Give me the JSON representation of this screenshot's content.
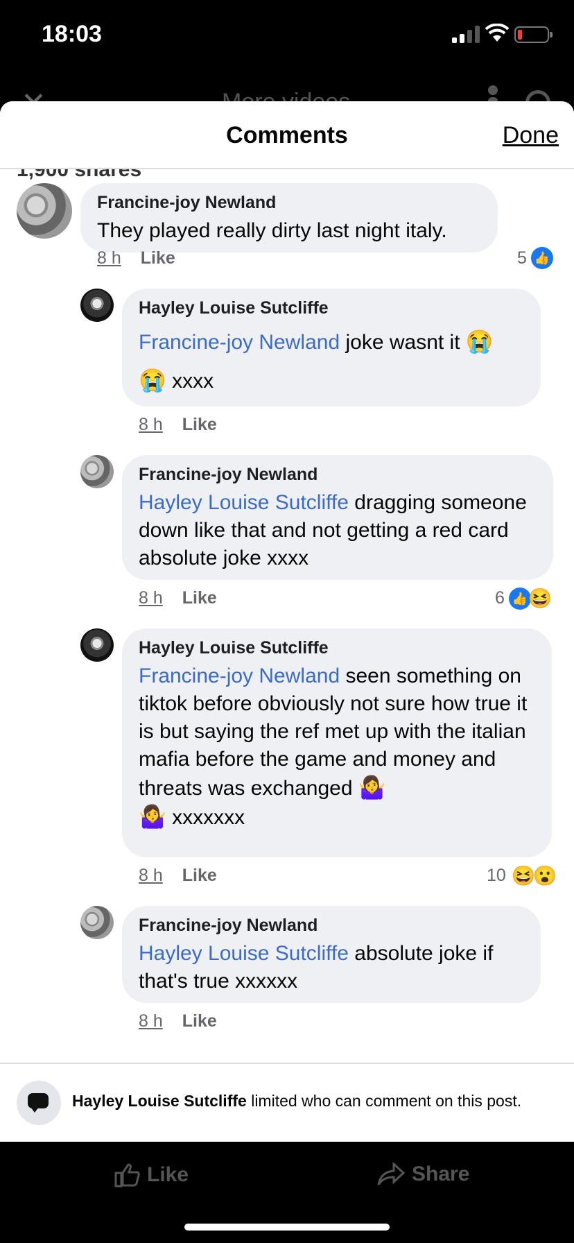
{
  "status_bar": {
    "time": "18:03"
  },
  "background": {
    "title": "More videos"
  },
  "sheet": {
    "title": "Comments",
    "done_label": "Done",
    "shares_peek": "1,900 shares"
  },
  "comments": [
    {
      "author": "Francine-joy Newland",
      "text": "They played really dirty last night italy.",
      "time": "8 h",
      "like_label": "Like",
      "reaction_count": "5"
    },
    {
      "author": "Hayley Louise Sutcliffe",
      "mention": "Francine-joy Newland",
      "text": " joke wasnt it ",
      "emoji1": "😭",
      "text2": " xxxx",
      "emoji2": "😭",
      "time": "8 h",
      "like_label": "Like"
    },
    {
      "author": "Francine-joy Newland",
      "mention": "Hayley Louise Sutcliffe",
      "text": " dragging someone down like that and not getting a red card absolute joke xxxx",
      "time": "8 h",
      "like_label": "Like",
      "reaction_count": "6",
      "reaction_emoji": "😆"
    },
    {
      "author": "Hayley Louise Sutcliffe",
      "mention": "Francine-joy Newland",
      "text": " seen something on tiktok before obviously not sure how true it is but saying the ref met up with the italian mafia before the game and money and threats was exchanged ",
      "emoji1": "🤷‍♀️",
      "emoji2": "🤷‍♀️",
      "text2": " xxxxxxx",
      "time": "8 h",
      "like_label": "Like",
      "reaction_count": "10",
      "reaction_emoji1": "😆",
      "reaction_emoji2": "😮"
    },
    {
      "author": "Francine-joy Newland",
      "mention": "Hayley Louise Sutcliffe",
      "text": " absolute joke if that's true xxxxxx",
      "time": "8 h",
      "like_label": "Like"
    }
  ],
  "notice": {
    "name": "Hayley Louise Sutcliffe",
    "text": " limited who can comment on this post."
  },
  "actions": {
    "like_label": "Like",
    "share_label": "Share"
  },
  "colors": {
    "mention": "#3b6bc7",
    "like_blue": "#1877f2",
    "bubble": "#eff0f3"
  }
}
